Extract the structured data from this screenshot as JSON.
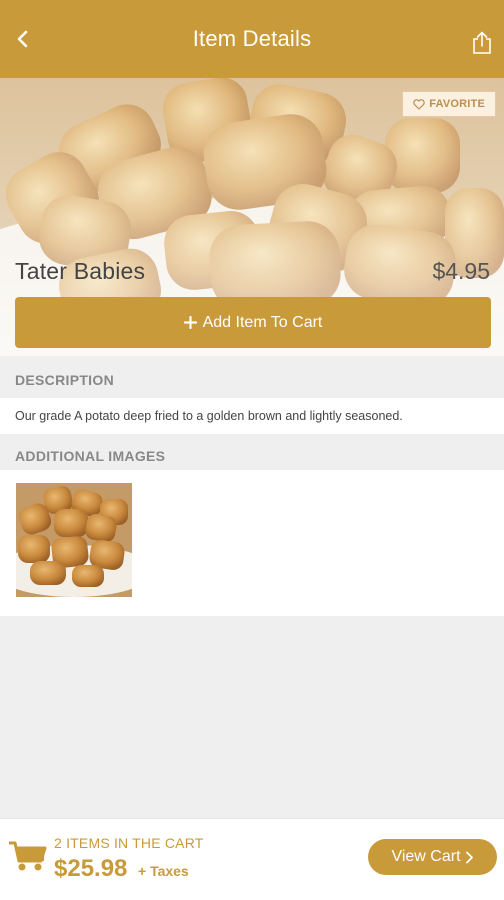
{
  "header": {
    "title": "Item Details",
    "back_icon": "chevron-left-icon",
    "share_icon": "share-icon"
  },
  "item": {
    "name": "Tater Babies",
    "price": "$4.95",
    "favorite_label": "FAVORITE",
    "add_to_cart_label": "Add Item To Cart"
  },
  "description": {
    "heading": "DESCRIPTION",
    "text": "Our grade A potato deep fried to a golden brown and lightly seasoned."
  },
  "additional_images": {
    "heading": "ADDITIONAL IMAGES",
    "count": 1
  },
  "cart": {
    "items_label": "2 ITEMS IN THE CART",
    "total": "$25.98",
    "taxes_label": "+ Taxes",
    "view_cart_label": "View Cart"
  },
  "colors": {
    "accent": "#c99a3a",
    "background": "#efefef",
    "favorite_text": "#b88f4e"
  }
}
